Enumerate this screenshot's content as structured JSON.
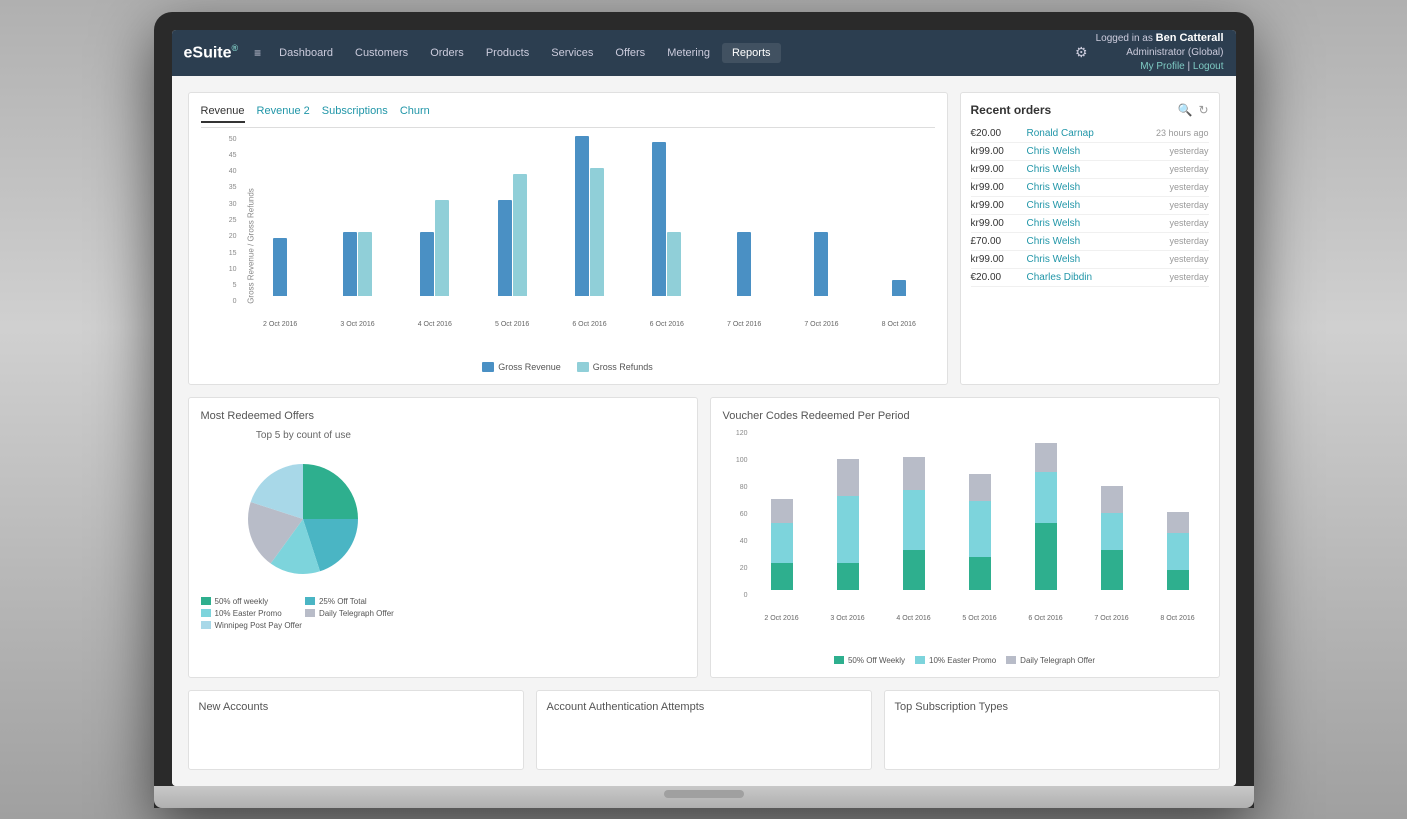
{
  "app": {
    "logo": "eSuite",
    "logo_sup": "®"
  },
  "nav": {
    "hamburger": "≡",
    "items": [
      {
        "label": "Dashboard",
        "active": false
      },
      {
        "label": "Customers",
        "active": false
      },
      {
        "label": "Orders",
        "active": false
      },
      {
        "label": "Products",
        "active": false
      },
      {
        "label": "Services",
        "active": false
      },
      {
        "label": "Offers",
        "active": false
      },
      {
        "label": "Metering",
        "active": false
      },
      {
        "label": "Reports",
        "active": true
      }
    ],
    "user": {
      "logged_in_label": "Logged in as",
      "name": "Ben Catterall",
      "role": "Administrator (Global)",
      "my_profile": "My Profile",
      "separator": " | ",
      "logout": "Logout"
    }
  },
  "revenue_chart": {
    "tabs": [
      "Revenue",
      "Revenue 2",
      "Subscriptions",
      "Churn"
    ],
    "active_tab": 0,
    "y_labels": [
      "50",
      "45",
      "40",
      "35",
      "30",
      "25",
      "20",
      "15",
      "10",
      "5",
      "0"
    ],
    "y_axis_label": "Gross Revenue / Gross Refunds",
    "bars": [
      {
        "label": "2 Oct 2016",
        "revenue": 18,
        "refund": 0
      },
      {
        "label": "3 Oct 2016",
        "revenue": 20,
        "refund": 20
      },
      {
        "label": "4 Oct 2016",
        "revenue": 20,
        "refund": 30
      },
      {
        "label": "5 Oct 2016",
        "revenue": 30,
        "refund": 38
      },
      {
        "label": "6 Oct 2016",
        "revenue": 50,
        "refund": 40
      },
      {
        "label": "6 Oct 2016",
        "revenue": 48,
        "refund": 20
      },
      {
        "label": "7 Oct 2016",
        "revenue": 20,
        "refund": 0
      },
      {
        "label": "7 Oct 2016",
        "revenue": 20,
        "refund": 0
      },
      {
        "label": "8 Oct 2016",
        "revenue": 5,
        "refund": 0
      }
    ],
    "legend": {
      "revenue_color": "#4a90c4",
      "refund_color": "#90cfd8",
      "revenue_label": "Gross Revenue",
      "refund_label": "Gross Refunds"
    }
  },
  "recent_orders": {
    "title": "Recent orders",
    "search_icon": "🔍",
    "refresh_icon": "↻",
    "orders": [
      {
        "amount": "€20.00",
        "name": "Ronald Carnap",
        "time": "23 hours ago"
      },
      {
        "amount": "kr99.00",
        "name": "Chris Welsh",
        "time": "yesterday"
      },
      {
        "amount": "kr99.00",
        "name": "Chris Welsh",
        "time": "yesterday"
      },
      {
        "amount": "kr99.00",
        "name": "Chris Welsh",
        "time": "yesterday"
      },
      {
        "amount": "kr99.00",
        "name": "Chris Welsh",
        "time": "yesterday"
      },
      {
        "amount": "kr99.00",
        "name": "Chris Welsh",
        "time": "yesterday"
      },
      {
        "amount": "£70.00",
        "name": "Chris Welsh",
        "time": "yesterday"
      },
      {
        "amount": "kr99.00",
        "name": "Chris Welsh",
        "time": "yesterday"
      },
      {
        "amount": "€20.00",
        "name": "Charles Dibdin",
        "time": "yesterday"
      }
    ]
  },
  "most_redeemed": {
    "title": "Most Redeemed Offers",
    "donut_title": "Top 5 by count of use",
    "segments": [
      {
        "label": "50% off weekly",
        "color": "#2eaf8e",
        "value": 25
      },
      {
        "label": "25% Off Total",
        "color": "#4ab5c4",
        "value": 20
      },
      {
        "label": "10% Easter Promo",
        "color": "#7dd4dc",
        "value": 15
      },
      {
        "label": "Daily Telegraph Offer",
        "color": "#b8bcc8",
        "value": 20
      },
      {
        "label": "Winnipeg Post Pay Offer",
        "color": "#a8d8e8",
        "value": 20
      }
    ]
  },
  "voucher_codes": {
    "title": "Voucher Codes Redeemed Per Period",
    "y_max": 120,
    "bars": [
      {
        "label": "2 Oct 2016",
        "s1": 20,
        "s2": 30,
        "s3": 18
      },
      {
        "label": "3 Oct 2016",
        "s1": 20,
        "s2": 50,
        "s3": 28
      },
      {
        "label": "4 Oct 2016",
        "s1": 30,
        "s2": 45,
        "s3": 25
      },
      {
        "label": "5 Oct 2016",
        "s1": 25,
        "s2": 42,
        "s3": 20
      },
      {
        "label": "6 Oct 2016",
        "s1": 50,
        "s2": 38,
        "s3": 22
      },
      {
        "label": "7 Oct 2016",
        "s1": 30,
        "s2": 28,
        "s3": 20
      },
      {
        "label": "8 Oct 2016",
        "s1": 15,
        "s2": 28,
        "s3": 16
      }
    ],
    "legend": [
      {
        "label": "50% Off Weekly",
        "color": "#2eaf8e"
      },
      {
        "label": "10% Easter Promo",
        "color": "#7dd4dc"
      },
      {
        "label": "Daily Telegraph Offer",
        "color": "#b8bcc8"
      }
    ]
  },
  "bottom_sections": {
    "new_accounts": "New Accounts",
    "account_auth": "Account Authentication Attempts",
    "top_subs": "Top Subscription Types"
  }
}
